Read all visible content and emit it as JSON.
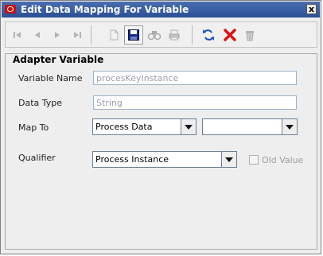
{
  "window": {
    "title": "Edit Data Mapping For Variable",
    "close_label": "x"
  },
  "toolbar": {
    "buttons": [
      {
        "name": "first-record-icon",
        "enabled": false
      },
      {
        "name": "previous-record-icon",
        "enabled": false
      },
      {
        "name": "next-record-icon",
        "enabled": false
      },
      {
        "name": "last-record-icon",
        "enabled": false
      },
      {
        "name": "new-document-icon",
        "enabled": false
      },
      {
        "name": "save-icon",
        "enabled": true
      },
      {
        "name": "find-icon",
        "enabled": false
      },
      {
        "name": "print-icon",
        "enabled": false
      },
      {
        "name": "refresh-icon",
        "enabled": true
      },
      {
        "name": "delete-x-icon",
        "enabled": true
      },
      {
        "name": "trash-icon",
        "enabled": false
      }
    ]
  },
  "panel": {
    "title": "Adapter Variable",
    "variable_name_label": "Variable Name",
    "variable_name_value": "procesKeyInstance",
    "data_type_label": "Data Type",
    "data_type_value": "String",
    "map_to_label": "Map To",
    "map_to_value": "Process Data",
    "map_to_secondary_value": "",
    "qualifier_label": "Qualifier",
    "qualifier_value": "Process Instance",
    "old_value_label": "Old Value",
    "old_value_checked": false
  },
  "colors": {
    "titlebar": "#2a4f96",
    "save_blue": "#1a2a8a",
    "delete_red": "#e01010",
    "refresh_blue": "#1d4fc0"
  }
}
